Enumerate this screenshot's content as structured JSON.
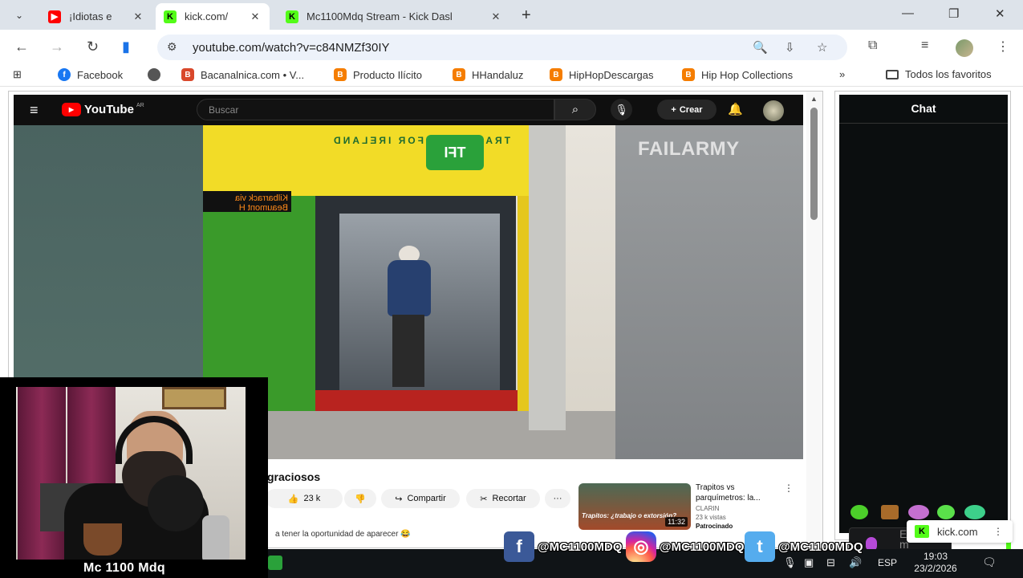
{
  "browser": {
    "tabs": [
      {
        "label": "¡Idiotas e",
        "favicon": "youtube-icon",
        "active": false
      },
      {
        "label": "kick.com/",
        "favicon": "kick-icon",
        "active": true
      },
      {
        "label": "Mc1100Mdq Stream - Kick Dasl",
        "favicon": "kick-icon",
        "active": false
      }
    ],
    "close_glyph": "✕",
    "url": "youtube.com/watch?v=c84NMZf30IY",
    "bookmarks": [
      {
        "label": "Facebook",
        "icon": "facebook-icon"
      },
      {
        "label": "Bacanalnica.com • V...",
        "icon": "bacanalnica-icon"
      },
      {
        "label": "Producto Ilícito",
        "icon": "blogger-icon"
      },
      {
        "label": "HHandaluz",
        "icon": "blogger-icon"
      },
      {
        "label": "HipHopDescargas",
        "icon": "blogger-icon"
      },
      {
        "label": "Hip Hop Collections",
        "icon": "blogger-icon"
      }
    ],
    "all_bookmarks_label": "Todos los favoritos"
  },
  "youtube": {
    "logo_text": "YouTube",
    "logo_region": "AR",
    "search_placeholder": "Buscar",
    "create_label": "Crear",
    "video_watermark": "FAILARMY",
    "scene_transport_text": "TRANSPORT FOR IRELAND",
    "scene_logo_text": "TFI",
    "scene_destination": "Kilbarrack via Beaumont H",
    "video_title": "graciosos",
    "like_count": "23 k",
    "share_label": "Compartir",
    "clip_label": "Recortar",
    "description_snippet": "a tener la oportunidad de aparecer 😂",
    "recommendation": {
      "title": "Trapitos vs parquímetros: la...",
      "channel": "CLARIN",
      "views": "23 k vistas",
      "sponsored": "Patrocinado",
      "duration": "11:32",
      "thumb_caption": "Trapitos: ¿trabajo o extorsión?"
    }
  },
  "chat": {
    "title": "Chat",
    "input_placeholder": "Enviar un m",
    "kick_label": "kick.com",
    "accent": "#53fc18"
  },
  "stream_overlay": {
    "streamer_name": "Mc 1100 Mdq",
    "social": [
      {
        "network": "facebook",
        "handle": "@MC1100MDQ"
      },
      {
        "network": "instagram",
        "handle": "@MC1100MDQ"
      },
      {
        "network": "twitter",
        "handle": "@MC1100MDQ"
      }
    ]
  },
  "taskbar": {
    "language": "ESP",
    "time": "19:03",
    "date": "23/2/2026"
  }
}
